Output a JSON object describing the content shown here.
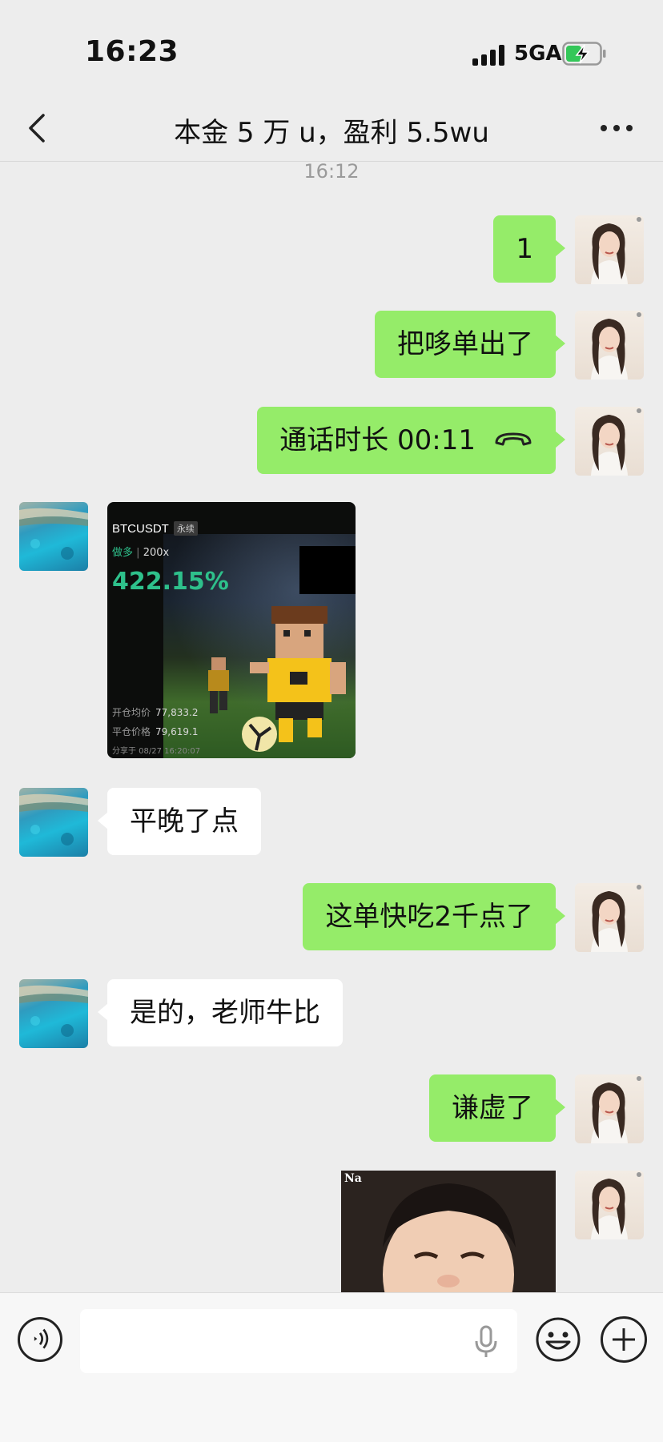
{
  "status_bar": {
    "time": "16:23",
    "network": "5GA"
  },
  "nav": {
    "title": "本金 5 万 u，盈利 5.5wu"
  },
  "timestamp": "16:12",
  "messages": {
    "m1": {
      "text": "1"
    },
    "m2": {
      "text": "把哆单出了"
    },
    "m3": {
      "text": "通话时长 00:11"
    },
    "m5": {
      "text": "平晚了点"
    },
    "m6": {
      "text": "这单快吃2千点了"
    },
    "m7": {
      "text": "是的，老师牛比"
    },
    "m8": {
      "text": "谦虚了"
    }
  },
  "trade_card": {
    "symbol": "BTCUSDT",
    "tag": "永续",
    "side": "做多",
    "leverage": "200x",
    "percent": "422.15%",
    "open_label": "开仓均价",
    "open_value": "77,833.2",
    "close_label": "平仓价格",
    "close_value": "79,619.1",
    "share_text": "分享于 08/27 16:20:07"
  },
  "sticker": {
    "watermark": "Na"
  },
  "input": {
    "placeholder": ""
  },
  "colors": {
    "background": "#ededed",
    "self_bubble": "#95ec69",
    "other_bubble": "#ffffff",
    "profit": "#2ec08b"
  }
}
